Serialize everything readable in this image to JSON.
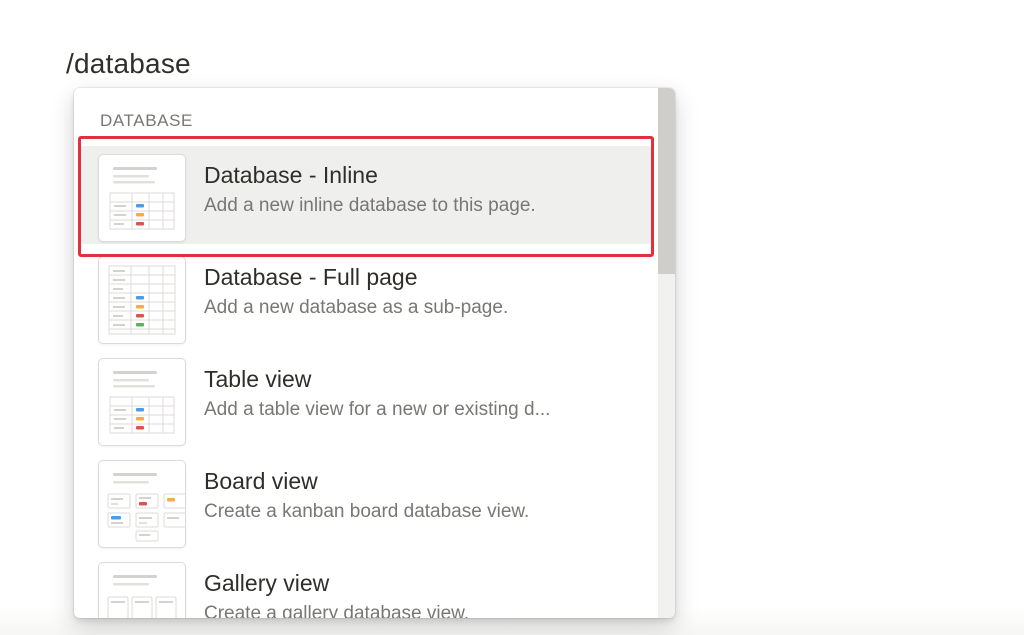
{
  "editor": {
    "command_text": "/database"
  },
  "menu": {
    "section_label": "DATABASE",
    "items": [
      {
        "title": "Database - Inline",
        "description": "Add a new inline database to this page.",
        "icon": "inline-database-thumbnail-icon",
        "highlighted": true
      },
      {
        "title": "Database - Full page",
        "description": "Add a new database as a sub-page.",
        "icon": "full-page-database-thumbnail-icon",
        "highlighted": false
      },
      {
        "title": "Table view",
        "description": "Add a table view for a new or existing d...",
        "icon": "table-view-thumbnail-icon",
        "highlighted": false
      },
      {
        "title": "Board view",
        "description": "Create a kanban board database view.",
        "icon": "board-view-thumbnail-icon",
        "highlighted": false
      },
      {
        "title": "Gallery view",
        "description": "Create a gallery database view.",
        "icon": "gallery-view-thumbnail-icon",
        "highlighted": false
      }
    ]
  },
  "colors": {
    "highlight_outline": "#e2313c",
    "hover_background": "#efefee",
    "tag_blue": "#4a9ee8",
    "tag_orange": "#f4ae3d",
    "tag_red": "#e0524c",
    "tag_green": "#5db35d"
  }
}
